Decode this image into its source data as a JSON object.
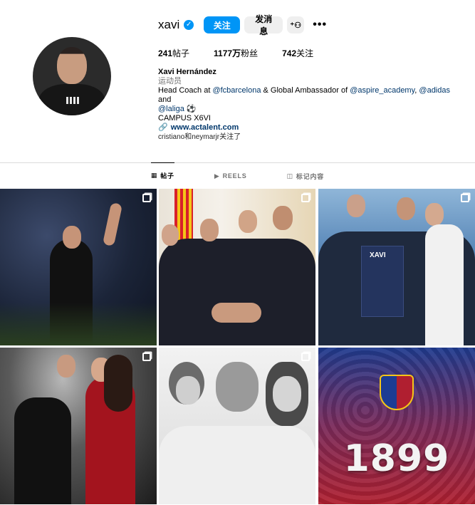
{
  "profile": {
    "username": "xavi",
    "verified_icon": "✓",
    "follow_label": "关注",
    "message_label": "发消息",
    "add_user_icon": "⁺⚇",
    "more_icon": "•••"
  },
  "stats": {
    "posts": "241",
    "posts_label": "帖子",
    "followers": "1177万",
    "followers_label": "粉丝",
    "following": "742",
    "following_label": "关注"
  },
  "bio": {
    "name": "Xavi Hernández",
    "category": "运动员",
    "line_prefix": "Head Coach at ",
    "tag_barca": "@fcbarcelona",
    "mid": " & Global Ambassador of ",
    "tag_aspire": "@aspire_academy",
    "comma": ", ",
    "tag_adidas": "@adidas",
    "and": " and",
    "tag_laliga": "@laliga",
    "ball": " ⚽",
    "campus": "CAMPUS X6VI",
    "link_icon": "🔗",
    "link": "www.actalent.com"
  },
  "followed_by": "cristiano和neymarjr关注了",
  "tabs": [
    {
      "icon": "▦",
      "label": "帖子"
    },
    {
      "icon": "▶",
      "label": "REELS"
    },
    {
      "icon": "◫",
      "label": "标记内容"
    }
  ],
  "posts": [
    {
      "caption": ""
    },
    {
      "caption": ""
    },
    {
      "caption": "XAVI"
    },
    {
      "caption": ""
    },
    {
      "caption": ""
    },
    {
      "caption": "1899"
    }
  ],
  "colors": {
    "accent": "#0095f6",
    "link": "#00376b",
    "muted": "#737373"
  }
}
